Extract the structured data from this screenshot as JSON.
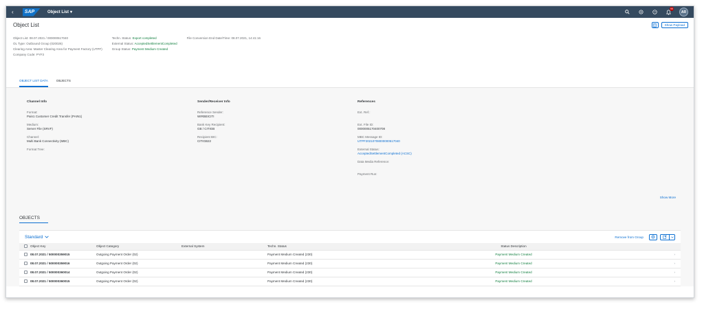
{
  "shell": {
    "logo": "SAP",
    "app_title": "Object List",
    "avatar": "AR",
    "notification_count": "99"
  },
  "header": {
    "title": "Object List",
    "show_payload": "Show Payload",
    "col1": [
      "Object List: 08.07.2021 / 000000517040",
      "OL Type: Outbound Group (020026)",
      "Clearing Area: Master Clearing Area for Payment Factory (UTPF)",
      "Company Code: PYF3"
    ],
    "col2": [
      {
        "label": "Techn. Status: ",
        "value": "Export completed"
      },
      {
        "label": "External Status: ",
        "value": "AcceptedSettlementCompleted"
      },
      {
        "label": "Group Status: ",
        "value": "Payment Medium Created"
      }
    ],
    "col3": "File Conversion End Date/Time: 08.07.2021, 14:41:16",
    "tabs": [
      "OBJECT LIST DATA",
      "OBJECTS"
    ]
  },
  "channel": {
    "title": "Channel Info",
    "fields": [
      {
        "label": "Format:",
        "value": "Pain1 Customer Credit Transfer (PAIN1)"
      },
      {
        "label": "Medium:",
        "value": "Server File (SRVF)"
      },
      {
        "label": "Channel:",
        "value": "Multi Bank Connectivity (MBC)"
      },
      {
        "label": "Format Tree:",
        "value": ""
      }
    ]
  },
  "sender": {
    "title": "Sender/Receiver Info",
    "fields": [
      {
        "label": "Reference Sender:",
        "value": "WIRBEICITI"
      },
      {
        "label": "Bank Key Recipient:",
        "value": "GB / CITIGB"
      },
      {
        "label": "Recipient BIC:",
        "value": "CITIGB22"
      }
    ]
  },
  "references": {
    "title": "References",
    "fields": [
      {
        "label": "Ext. Ref.:",
        "value": ""
      },
      {
        "label": "Ext. File ID:",
        "value": "0000005170400708"
      },
      {
        "label": "MBC Message ID:",
        "value": "UTPF20210708000000517040"
      },
      {
        "label": "External Status:",
        "value": "AcceptedSettlementCompleted (ACSC)"
      },
      {
        "label": "Data Media Reference:",
        "value": ""
      },
      {
        "label": "Payment Run:",
        "value": ""
      }
    ]
  },
  "show_more": "Show More",
  "objects": {
    "section_title": "OBJECTS",
    "variant": "Standard",
    "remove_from_group": "Remove from Group",
    "columns": [
      "Object Key",
      "Object Category",
      "External System",
      "Techn. Status",
      "Status Description"
    ],
    "rows": [
      [
        "08.07.2021 / 500000359015",
        "Outgoing Payment Order (02)",
        "",
        "Payment Medium Created (230)",
        "Payment Medium Created"
      ],
      [
        "08.07.2021 / 500000359016",
        "Outgoing Payment Order (02)",
        "",
        "Payment Medium Created (230)",
        "Payment Medium Created"
      ],
      [
        "08.07.2021 / 500000360014",
        "Outgoing Payment Order (02)",
        "",
        "Payment Medium Created (230)",
        "Payment Medium Created"
      ],
      [
        "08.07.2021 / 500000360015",
        "Outgoing Payment Order (02)",
        "",
        "Payment Medium Created (230)",
        "Payment Medium Created"
      ]
    ]
  },
  "colors": {
    "shell": "#354a5f",
    "brand": "#1172c7",
    "link": "#0a6ed1",
    "positive": "#107e3e"
  }
}
